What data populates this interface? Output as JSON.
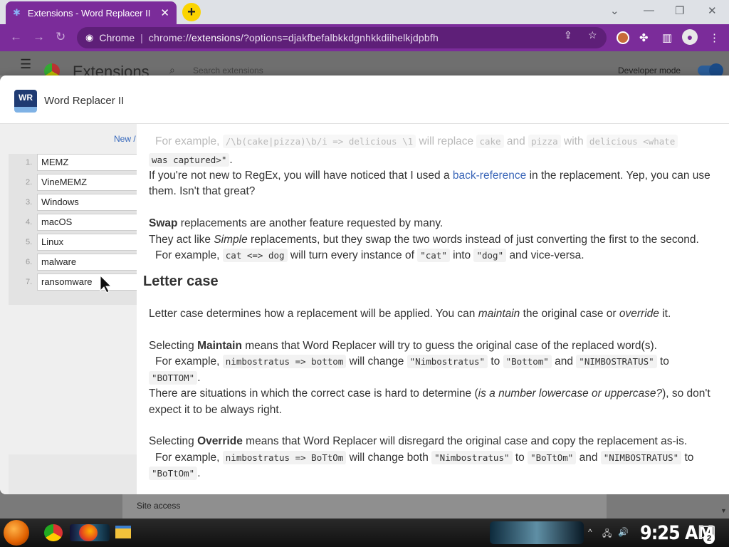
{
  "browser": {
    "tab_title": "Extensions - Word Replacer II",
    "tab_close": "✕",
    "new_tab": "+",
    "omnibox_label": "Chrome",
    "url_sep": "|",
    "url_prefix": "chrome://",
    "url_host": "extensions",
    "url_rest": "/?options=djakfbefalbkkdgnhkkdiihelkjdpbfh"
  },
  "extensions_page": {
    "title": "Extensions",
    "search_placeholder": "Search extensions",
    "developer_mode_label": "Developer mode",
    "developer_mode_on": true,
    "site_access_label": "Site access"
  },
  "dialog": {
    "logo_text": "WR",
    "title": "Word Replacer II",
    "new_button": "New /",
    "replacement_list": [
      {
        "num": "1.",
        "name": "MEMZ"
      },
      {
        "num": "2.",
        "name": "VineMEMZ"
      },
      {
        "num": "3.",
        "name": "Windows"
      },
      {
        "num": "4.",
        "name": "macOS"
      },
      {
        "num": "5.",
        "name": "Linux"
      },
      {
        "num": "6.",
        "name": "malware"
      },
      {
        "num": "7.",
        "name": "ransomware"
      }
    ]
  },
  "help": {
    "l0_pre": "For example,",
    "l0_code1": "/\\b(cake|pizza)\\b/i => delicious \\1",
    "l0_mid1": "will replace",
    "l0_code2": "cake",
    "l0_and": "and",
    "l0_code3": "pizza",
    "l0_with": "with",
    "l0_code4": "delicious <whate",
    "l1_code": "was captured>\"",
    "l1_end": ".",
    "l2_pre": "If you're not new to RegEx, you will have noticed that I used a",
    "l2_link": "back-reference",
    "l2_post": "in the replacement. Yep, you can use",
    "l3": "them. Isn't that great?",
    "l4_bold": "Swap",
    "l4_rest": "replacements are another feature requested by many.",
    "l5_pre": "They act like",
    "l5_ital": "Simple",
    "l5_post": "replacements, but they swap the two words instead of just converting the first to the second.",
    "l6_pre": "For example,",
    "l6_code1": "cat <=> dog",
    "l6_mid": "will turn every instance of",
    "l6_code2": "\"cat\"",
    "l6_into": "into",
    "l6_code3": "\"dog\"",
    "l6_post": "and vice-versa.",
    "heading_letter_case": "Letter case",
    "l7_pre": "Letter case determines how a replacement will be applied. You can",
    "l7_ital1": "maintain",
    "l7_mid": "the original case or",
    "l7_ital2": "override",
    "l7_post": "it.",
    "l8_pre": "Selecting",
    "l8_bold": "Maintain",
    "l8_post": "means that Word Replacer will try to guess the original case of the replaced word(s).",
    "l9_pre": "For example,",
    "l9_code1": "nimbostratus => bottom",
    "l9_mid": "will change",
    "l9_code2": "\"Nimbostratus\"",
    "l9_to": "to",
    "l9_code3": "\"Bottom\"",
    "l9_and": "and",
    "l9_code4": "\"NIMBOSTRATUS\"",
    "l9_to2": "to",
    "l10_code": "\"BOTTOM\"",
    "l10_end": ".",
    "l11_pre": "There are situations in which the correct case is hard to determine (",
    "l11_ital": "is a number lowercase or uppercase?",
    "l11_post": "), so don't",
    "l12": "expect it to be always right.",
    "l13_pre": "Selecting",
    "l13_bold": "Override",
    "l13_post": "means that Word Replacer will disregard the original case and copy the replacement as-is.",
    "l14_pre": "For example,",
    "l14_code1": "nimbostratus => BoTtOm",
    "l14_mid": "will change both",
    "l14_code2": "\"Nimbostratus\"",
    "l14_to": "to",
    "l14_code3": "\"BoTtOm\"",
    "l14_and": "and",
    "l14_code4": "\"NIMBOSTRATUS\"",
    "l14_to2": "to",
    "l15_code": "\"BoTtOm\"",
    "l15_end": "."
  },
  "taskbar": {
    "clock": "9:25 AM",
    "notification_count": "2"
  },
  "colors": {
    "browser_accent": "#7b2c9a",
    "link": "#3a66b8",
    "new_tab_button": "#fbd400"
  }
}
